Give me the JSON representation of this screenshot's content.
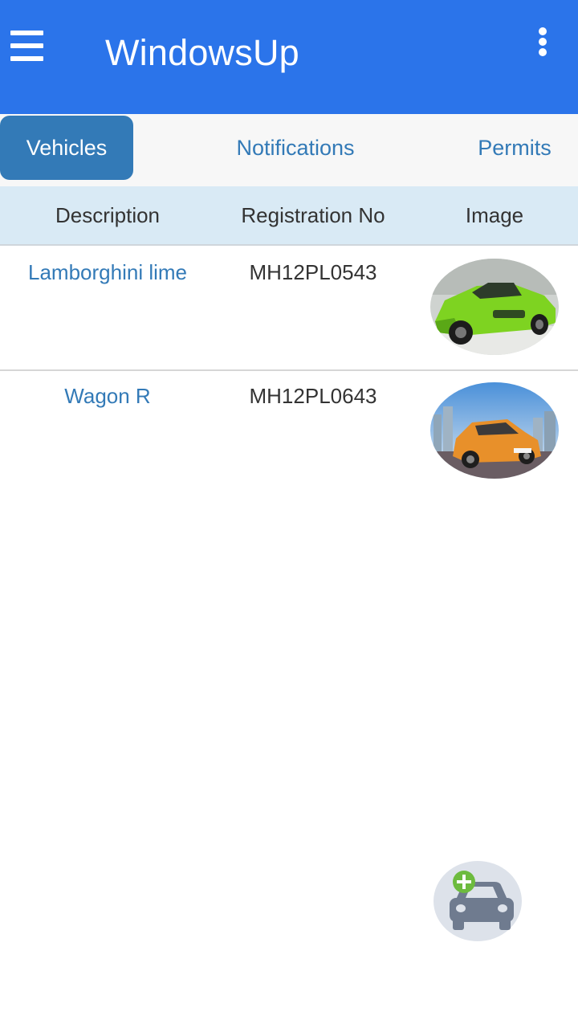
{
  "appbar": {
    "title": "WindowsUp",
    "menu_icon": "hamburger-menu-icon",
    "more_icon": "more-vertical-icon",
    "color": "#2b74ea"
  },
  "tabs": [
    {
      "label": "Vehicles",
      "active": true
    },
    {
      "label": "Notifications",
      "active": false
    },
    {
      "label": "Permits",
      "active": false
    }
  ],
  "table": {
    "columns": [
      "Description",
      "Registration No",
      "Image"
    ],
    "rows": [
      {
        "description": "Lamborghini lime",
        "registration": "MH12PL0543",
        "image": "green-sports-car-photo"
      },
      {
        "description": "Wagon R",
        "registration": "MH12PL0643",
        "image": "orange-hatchback-photo"
      }
    ]
  },
  "fab": {
    "icon": "add-vehicle-icon"
  },
  "colors": {
    "accent": "#337ab7",
    "header_bg": "#d9eaf5",
    "tab_bg": "#f7f7f7"
  }
}
